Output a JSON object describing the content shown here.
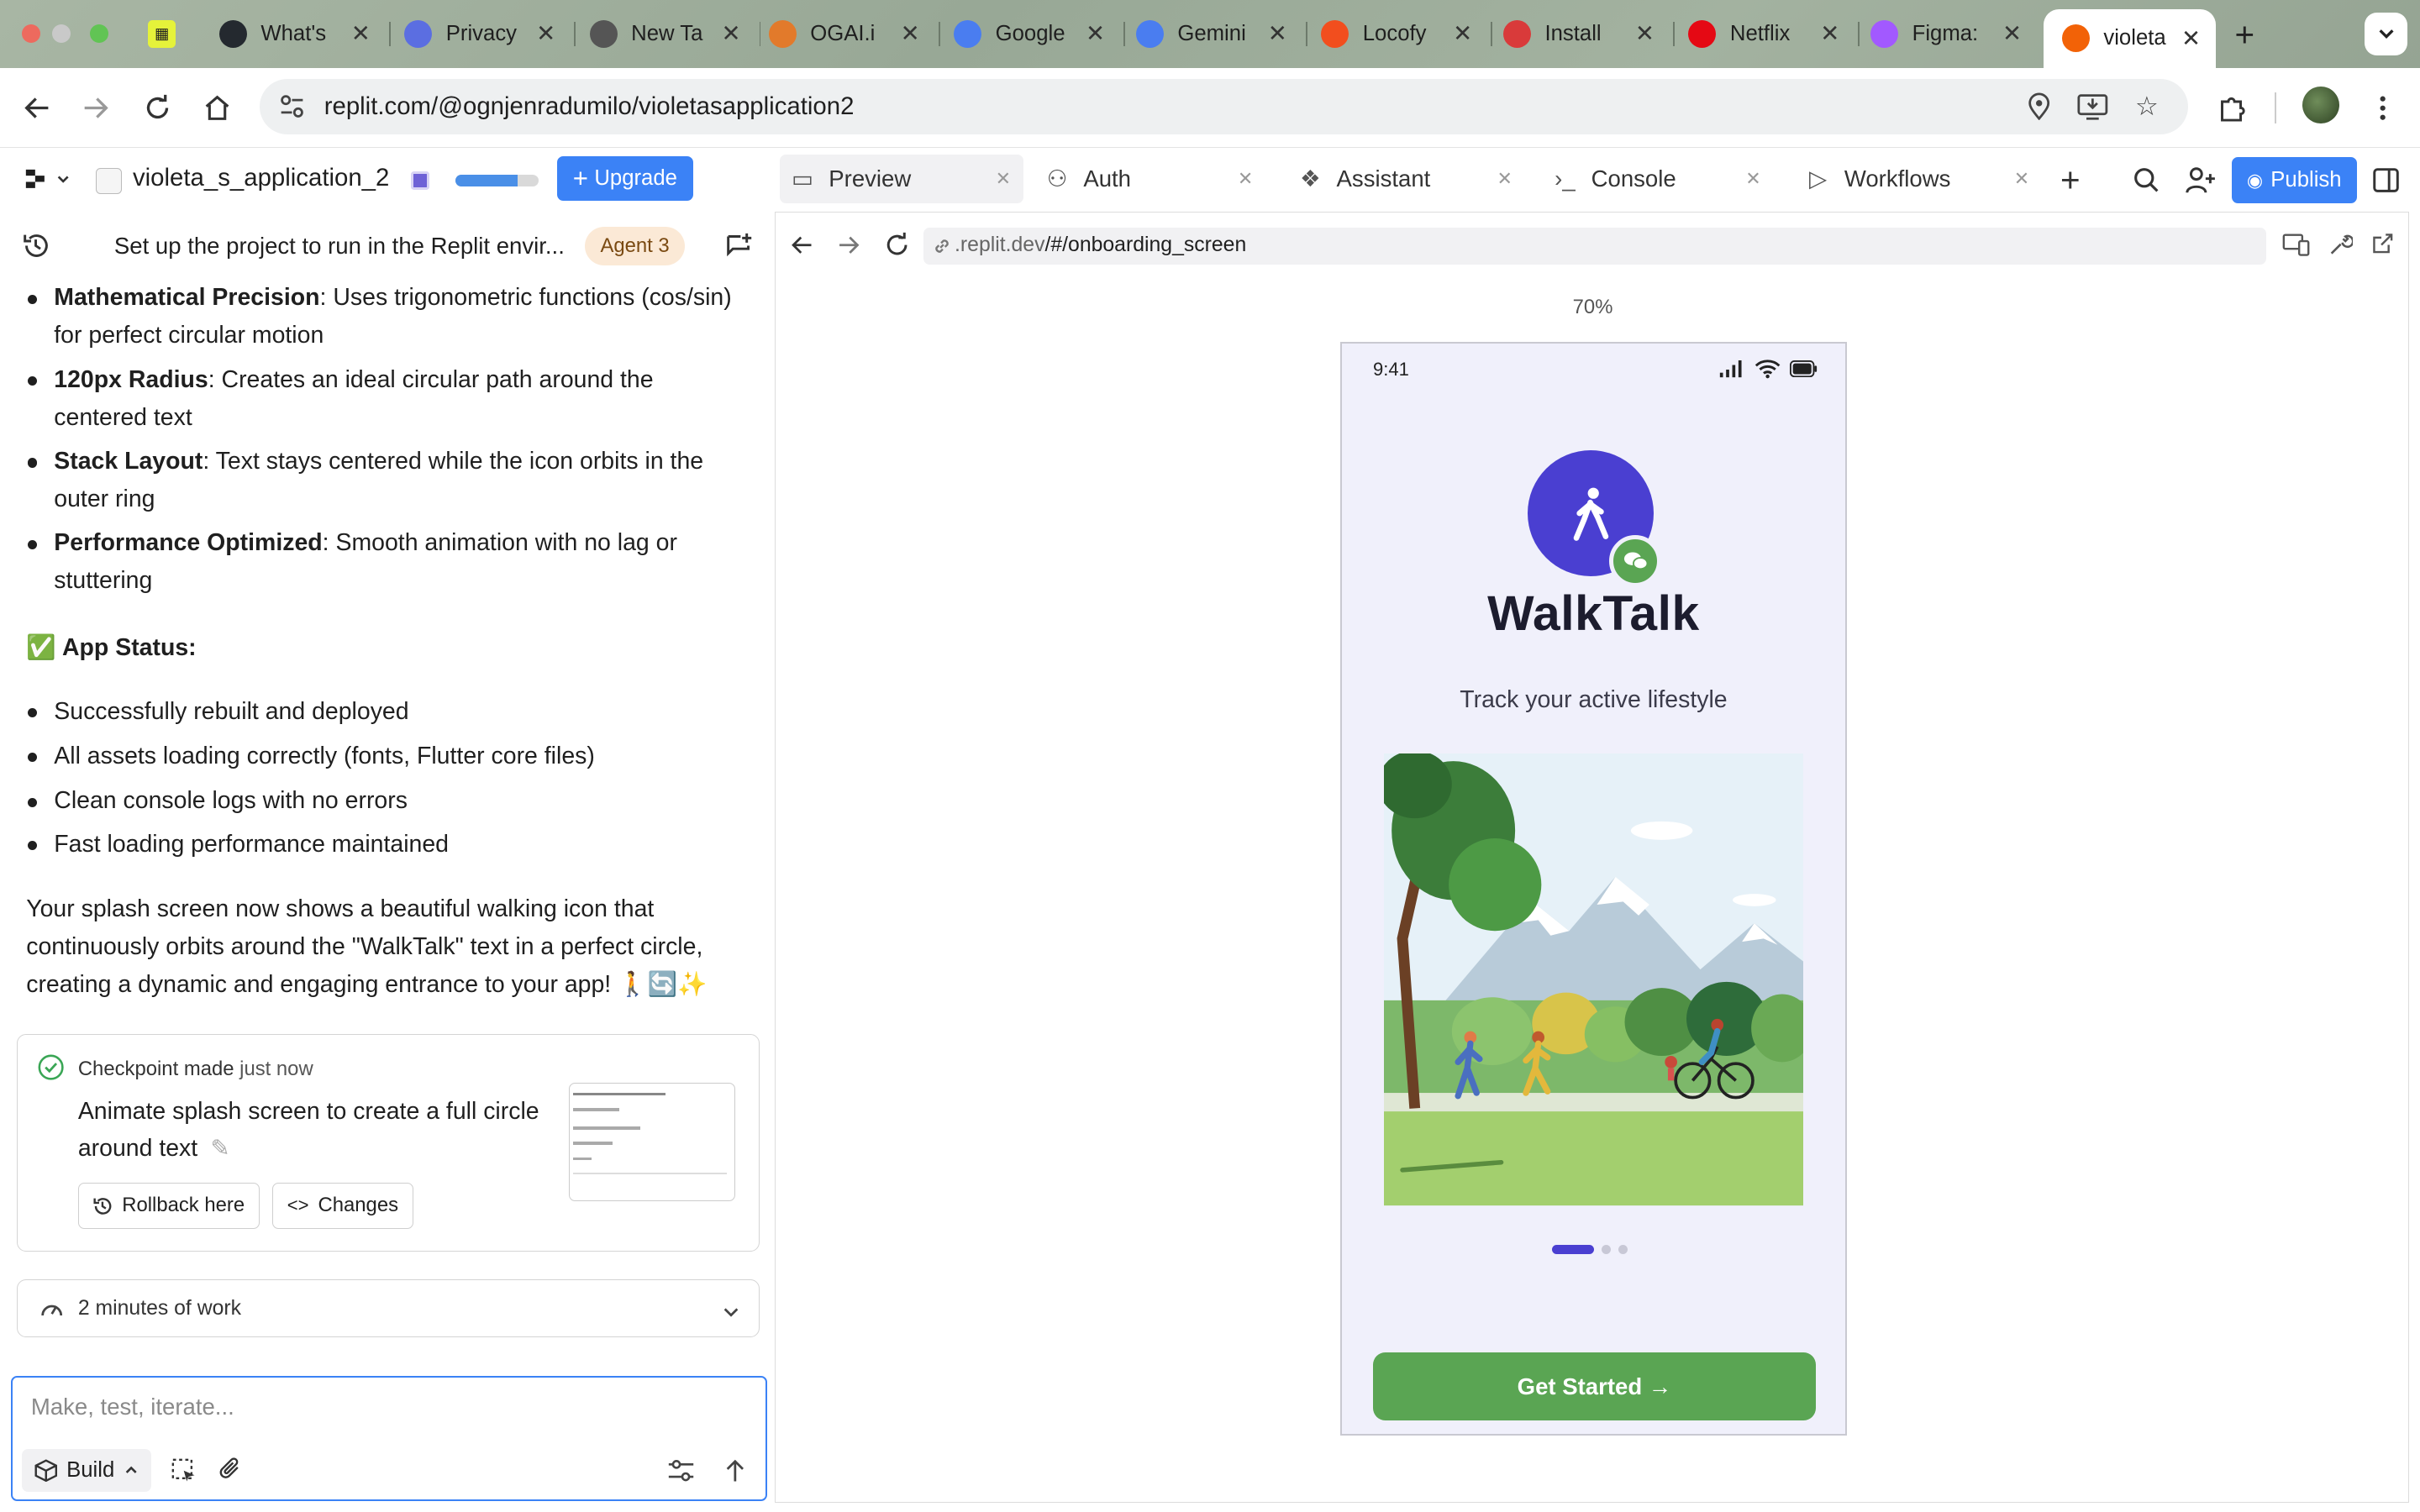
{
  "browser": {
    "tabs": [
      {
        "label": "",
        "icon": "tab-icon-favicon",
        "color": "#e5f23a"
      },
      {
        "label": "What's",
        "icon": "github-icon",
        "color": "#24292f"
      },
      {
        "label": "Privacy",
        "icon": "shield-icon",
        "color": "#5b6ee1"
      },
      {
        "label": "New Ta",
        "icon": "globe-icon",
        "color": "#555555"
      },
      {
        "label": "OGAI.i",
        "icon": "ogai-icon",
        "color": "#e27a2b"
      },
      {
        "label": "Google",
        "icon": "gemini-icon",
        "color": "#4a7df0"
      },
      {
        "label": "Gemini",
        "icon": "gemini-icon",
        "color": "#4a7df0"
      },
      {
        "label": "Locofy",
        "icon": "figma-icon",
        "color": "#f24e1e"
      },
      {
        "label": "Install",
        "icon": "play-icon",
        "color": "#d93a3a"
      },
      {
        "label": "Netflix",
        "icon": "netflix-icon",
        "color": "#e50914"
      },
      {
        "label": "Figma:",
        "icon": "figma-icon",
        "color": "#a259ff"
      },
      {
        "label": "violeta",
        "icon": "replit-icon",
        "color": "#f26207"
      }
    ],
    "address": "replit.com/@ognjenradumilo/violetasapplication2"
  },
  "replit": {
    "project_name": "violeta_s_application_2",
    "upgrade_label": "Upgrade",
    "plan_progress": 0.75,
    "pane_tabs": [
      {
        "label": "Preview",
        "icon": "monitor-icon"
      },
      {
        "label": "Auth",
        "icon": "user-check-icon"
      },
      {
        "label": "Assistant",
        "icon": "assistant-icon"
      },
      {
        "label": "Console",
        "icon": "terminal-icon"
      },
      {
        "label": "Workflows",
        "icon": "play-icon"
      }
    ],
    "publish_label": "Publish"
  },
  "chat": {
    "title": "Set up the project to run in the Replit envir...",
    "agent_badge": "Agent 3",
    "bullets_top": [
      {
        "bold": "Mathematical Precision",
        "text": ": Uses trigonometric functions (cos/sin) for perfect circular motion"
      },
      {
        "bold": "120px Radius",
        "text": ": Creates an ideal circular path around the centered text"
      },
      {
        "bold": "Stack Layout",
        "text": ": Text stays centered while the icon orbits in the outer ring"
      },
      {
        "bold": "Performance Optimized",
        "text": ": Smooth animation with no lag or stuttering"
      }
    ],
    "status_heading_emoji": "✅",
    "status_heading": "App Status:",
    "status_bullets": [
      "Successfully rebuilt and deployed",
      "All assets loading correctly (fonts, Flutter core files)",
      "Clean console logs with no errors",
      "Fast loading performance maintained"
    ],
    "summary": "Your splash screen now shows a beautiful walking icon that continuously orbits around the \"WalkTalk\" text in a perfect circle, creating a dynamic and engaging entrance to your app! 🚶🔄✨",
    "checkpoint": {
      "label": "Checkpoint made",
      "time": "just now",
      "message": "Animate splash screen to create a full circle around text",
      "rollback_label": "Rollback here",
      "changes_label": "Changes"
    },
    "work_summary": "2 minutes of work",
    "composer_placeholder": "Make, test, iterate...",
    "build_label": "Build"
  },
  "preview": {
    "url_host": ".replit.dev",
    "url_path": "/#/onboarding_screen",
    "zoom": "70%",
    "phone": {
      "time": "9:41",
      "app_title": "WalkTalk",
      "tagline": "Track your active lifestyle",
      "page_index": 1,
      "page_count": 3,
      "cta_label": "Get Started →",
      "brand_color": "#4a3fd1",
      "accent_color": "#5aa553"
    }
  }
}
